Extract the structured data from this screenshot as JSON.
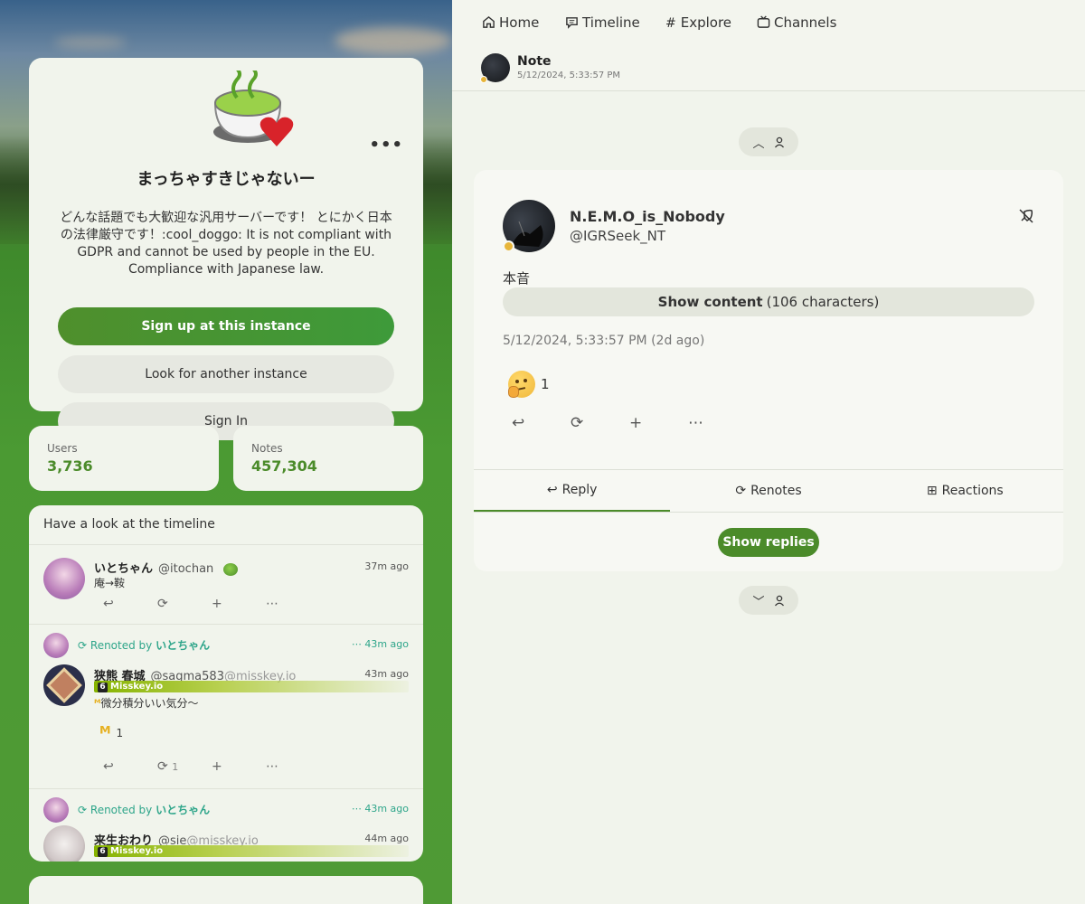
{
  "instance": {
    "name": "まっちゃすきじゃないー",
    "description": "どんな話題でも大歓迎な汎用サーバーです！ とにかく日本の法律厳守です！:cool_doggo: It is not compliant with GDPR and cannot be used by people in the EU. Compliance with Japanese law.",
    "more_label": "•••",
    "signup_label": "Sign up at this instance",
    "another_label": "Look for another instance",
    "signin_label": "Sign In"
  },
  "stats": {
    "users_label": "Users",
    "users_value": "3,736",
    "notes_label": "Notes",
    "notes_value": "457,304"
  },
  "timeline": {
    "header": "Have a look at the timeline",
    "notes": [
      {
        "name": "いとちゃん",
        "handle": "@itochan",
        "time": "37m ago",
        "text": "庵→鞍"
      },
      {
        "renoted_by_prefix": "Renoted by",
        "renoted_by": "いとちゃん",
        "renote_time": "43m ago",
        "name": "狭熊 春城",
        "handle": "@sagma583",
        "host": "@misskey.io",
        "time": "43m ago",
        "ticker": "Misskey.io",
        "text": "微分積分いい気分〜",
        "reaction_count": "1",
        "renote_count": "1"
      },
      {
        "renoted_by_prefix": "Renoted by",
        "renoted_by": "いとちゃん",
        "renote_time": "43m ago",
        "name": "来生おわり",
        "handle": "@sie",
        "host": "@misskey.io",
        "time": "44m ago",
        "ticker": "Misskey.io"
      }
    ]
  },
  "nav": {
    "items": [
      {
        "label": "Home",
        "icon": "home-icon"
      },
      {
        "label": "Timeline",
        "icon": "message-icon"
      },
      {
        "label": "Explore",
        "icon": "hash-icon"
      },
      {
        "label": "Channels",
        "icon": "tv-icon"
      }
    ]
  },
  "page_header": {
    "title": "Note",
    "subtitle": "5/12/2024, 5:33:57 PM"
  },
  "note": {
    "name": "N.E.M.O_is_Nobody",
    "handle": "@IGRSeek_NT",
    "cw": "本音",
    "show_content_bold": "Show content",
    "show_content_rest": "(106 characters)",
    "date": "5/12/2024, 5:33:57 PM (2d ago)",
    "reaction_count": "1",
    "tabs": [
      "Reply",
      "Renotes",
      "Reactions"
    ],
    "show_replies": "Show replies"
  },
  "colors": {
    "accent": "#4b8b2a",
    "renote": "#2ea58a",
    "online_dot": "#e7b53a"
  }
}
